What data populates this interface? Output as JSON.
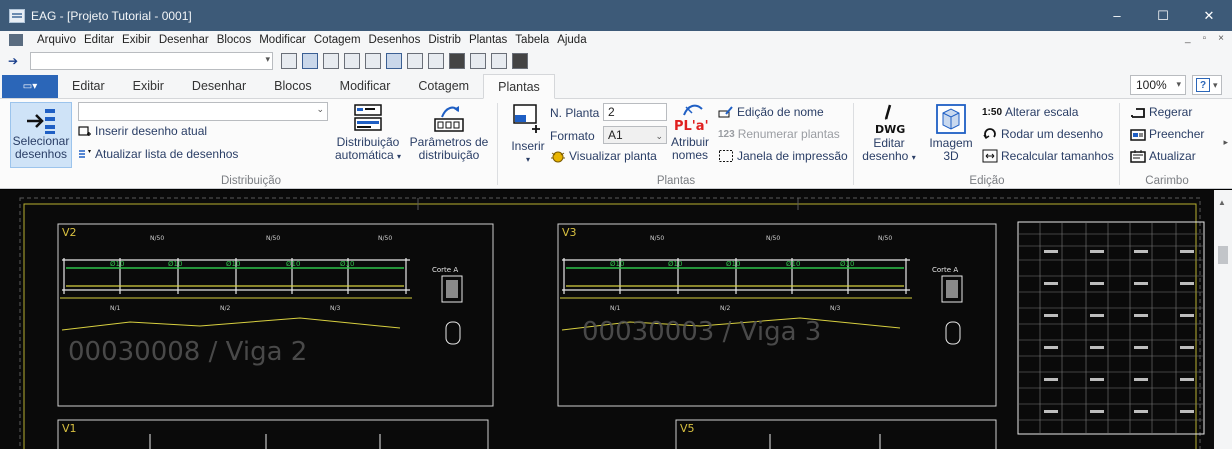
{
  "window": {
    "title": "EAG - [Projeto Tutorial - 0001]",
    "controls": [
      "–",
      "☐",
      "✕"
    ]
  },
  "menubar": {
    "items": [
      "Arquivo",
      "Editar",
      "Exibir",
      "Desenhar",
      "Blocos",
      "Modificar",
      "Cotagem",
      "Desenhos",
      "Distrib",
      "Plantas",
      "Tabela",
      "Ajuda"
    ],
    "mdi": [
      "_",
      "▫",
      "×"
    ]
  },
  "ribbon_tabs": {
    "items": [
      "Editar",
      "Exibir",
      "Desenhar",
      "Blocos",
      "Modificar",
      "Cotagem",
      "Plantas"
    ],
    "active": "Plantas",
    "zoom": "100%",
    "help": "?"
  },
  "ribbon": {
    "distribuicao": {
      "label": "Distribuição",
      "selecionar": "Selecionar desenhos",
      "selecionar_l1": "Selecionar",
      "selecionar_l2": "desenhos",
      "inserir_atual": "Inserir desenho atual",
      "atualizar_lista": "Atualizar lista de desenhos",
      "dist_auto_l1": "Distribuição",
      "dist_auto_l2": "automática",
      "params_l1": "Parâmetros de",
      "params_l2": "distribuição"
    },
    "plantas": {
      "label": "Plantas",
      "inserir": "Inserir",
      "n_planta_label": "N. Planta",
      "n_planta_value": "2",
      "formato_label": "Formato",
      "formato_value": "A1",
      "visualizar": "Visualizar planta",
      "atribuir_l1": "Atribuir",
      "atribuir_l2": "nomes",
      "atribuir_icon_text": "PL'a'",
      "edicao_nome": "Edição de nome",
      "renumerar": "Renumerar plantas",
      "renumerar_prefix": "123",
      "janela": "Janela de impressão"
    },
    "edicao": {
      "label": "Edição",
      "editar_l1": "Editar",
      "editar_l2": "desenho",
      "dwg": "DWG",
      "imagem_l1": "Imagem",
      "imagem_l2": "3D",
      "alterar_escala": "Alterar escala",
      "escala_prefix": "1:50",
      "rodar": "Rodar um desenho",
      "recalcular": "Recalcular tamanhos"
    },
    "carimbo": {
      "label": "Carimbo",
      "regerar": "Regerar",
      "preencher": "Preencher",
      "atualizar": "Atualizar"
    }
  },
  "drawing": {
    "sheets": [
      "V2",
      "V3",
      "V1",
      "V5"
    ],
    "watermarks": [
      "00030008 / Viga 2",
      "00030003 / Viga 3"
    ],
    "section_labels": [
      "Corte A",
      "Corte A"
    ],
    "colors": {
      "background": "#0a0a0a",
      "frame": "#b8b030",
      "green": "#2ec24a",
      "white": "#e8e8e8",
      "yellow": "#d8d040"
    }
  }
}
